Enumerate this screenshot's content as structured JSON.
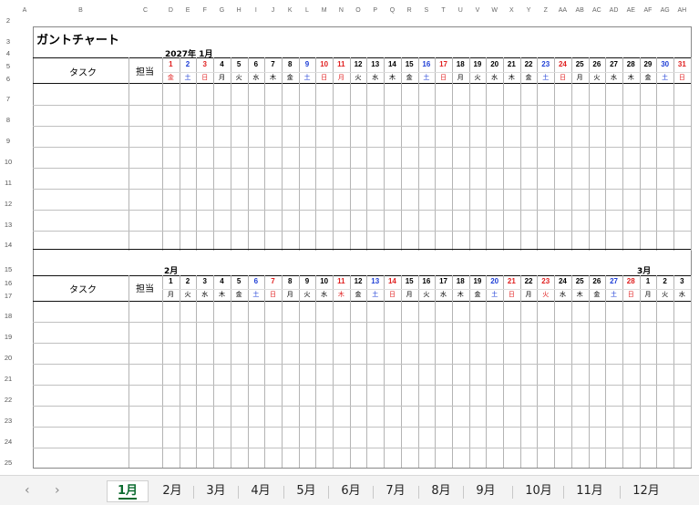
{
  "sheet": {
    "title": "ガントチャート",
    "column_letters": [
      "A",
      "B",
      "C",
      "D",
      "E",
      "F",
      "G",
      "H",
      "I",
      "J",
      "K",
      "L",
      "M",
      "N",
      "O",
      "P",
      "Q",
      "R",
      "S",
      "T",
      "U",
      "V",
      "W",
      "X",
      "Y",
      "Z",
      "AA",
      "AB",
      "AC",
      "AD",
      "AE",
      "AF",
      "AG",
      "AH"
    ],
    "row_numbers": [
      "2",
      "3",
      "4",
      "5",
      "6",
      "7",
      "8",
      "9",
      "10",
      "11",
      "12",
      "13",
      "14",
      "15",
      "16",
      "17",
      "18",
      "19",
      "20",
      "21",
      "22",
      "23",
      "24",
      "25"
    ],
    "colors": {
      "weekday": "#000000",
      "saturday": "#1f3fd6",
      "sunday_holiday": "#e02020",
      "grid": "#b4b4b4",
      "tab_active": "#0b6b2f"
    }
  },
  "block1": {
    "month_label": "2027年 1月",
    "task_header": "タスク",
    "owner_header": "担当",
    "days": [
      {
        "d": "1",
        "w": "金",
        "c": "h"
      },
      {
        "d": "2",
        "w": "土",
        "c": "s"
      },
      {
        "d": "3",
        "w": "日",
        "c": "h"
      },
      {
        "d": "4",
        "w": "月",
        "c": "n"
      },
      {
        "d": "5",
        "w": "火",
        "c": "n"
      },
      {
        "d": "6",
        "w": "水",
        "c": "n"
      },
      {
        "d": "7",
        "w": "木",
        "c": "n"
      },
      {
        "d": "8",
        "w": "金",
        "c": "n"
      },
      {
        "d": "9",
        "w": "土",
        "c": "s"
      },
      {
        "d": "10",
        "w": "日",
        "c": "h"
      },
      {
        "d": "11",
        "w": "月",
        "c": "h"
      },
      {
        "d": "12",
        "w": "火",
        "c": "n"
      },
      {
        "d": "13",
        "w": "水",
        "c": "n"
      },
      {
        "d": "14",
        "w": "木",
        "c": "n"
      },
      {
        "d": "15",
        "w": "金",
        "c": "n"
      },
      {
        "d": "16",
        "w": "土",
        "c": "s"
      },
      {
        "d": "17",
        "w": "日",
        "c": "h"
      },
      {
        "d": "18",
        "w": "月",
        "c": "n"
      },
      {
        "d": "19",
        "w": "火",
        "c": "n"
      },
      {
        "d": "20",
        "w": "水",
        "c": "n"
      },
      {
        "d": "21",
        "w": "木",
        "c": "n"
      },
      {
        "d": "22",
        "w": "金",
        "c": "n"
      },
      {
        "d": "23",
        "w": "土",
        "c": "s"
      },
      {
        "d": "24",
        "w": "日",
        "c": "h"
      },
      {
        "d": "25",
        "w": "月",
        "c": "n"
      },
      {
        "d": "26",
        "w": "火",
        "c": "n"
      },
      {
        "d": "27",
        "w": "水",
        "c": "n"
      },
      {
        "d": "28",
        "w": "木",
        "c": "n"
      },
      {
        "d": "29",
        "w": "金",
        "c": "n"
      },
      {
        "d": "30",
        "w": "土",
        "c": "s"
      },
      {
        "d": "31",
        "w": "日",
        "c": "h"
      }
    ]
  },
  "block2": {
    "month_label": "2月",
    "month_label_2": "3月",
    "task_header": "タスク",
    "owner_header": "担当",
    "days": [
      {
        "d": "1",
        "w": "月",
        "c": "n"
      },
      {
        "d": "2",
        "w": "火",
        "c": "n"
      },
      {
        "d": "3",
        "w": "水",
        "c": "n"
      },
      {
        "d": "4",
        "w": "木",
        "c": "n"
      },
      {
        "d": "5",
        "w": "金",
        "c": "n"
      },
      {
        "d": "6",
        "w": "土",
        "c": "s"
      },
      {
        "d": "7",
        "w": "日",
        "c": "h"
      },
      {
        "d": "8",
        "w": "月",
        "c": "n"
      },
      {
        "d": "9",
        "w": "火",
        "c": "n"
      },
      {
        "d": "10",
        "w": "水",
        "c": "n"
      },
      {
        "d": "11",
        "w": "木",
        "c": "h"
      },
      {
        "d": "12",
        "w": "金",
        "c": "n"
      },
      {
        "d": "13",
        "w": "土",
        "c": "s"
      },
      {
        "d": "14",
        "w": "日",
        "c": "h"
      },
      {
        "d": "15",
        "w": "月",
        "c": "n"
      },
      {
        "d": "16",
        "w": "火",
        "c": "n"
      },
      {
        "d": "17",
        "w": "水",
        "c": "n"
      },
      {
        "d": "18",
        "w": "木",
        "c": "n"
      },
      {
        "d": "19",
        "w": "金",
        "c": "n"
      },
      {
        "d": "20",
        "w": "土",
        "c": "s"
      },
      {
        "d": "21",
        "w": "日",
        "c": "h"
      },
      {
        "d": "22",
        "w": "月",
        "c": "n"
      },
      {
        "d": "23",
        "w": "火",
        "c": "h"
      },
      {
        "d": "24",
        "w": "水",
        "c": "n"
      },
      {
        "d": "25",
        "w": "木",
        "c": "n"
      },
      {
        "d": "26",
        "w": "金",
        "c": "n"
      },
      {
        "d": "27",
        "w": "土",
        "c": "s"
      },
      {
        "d": "28",
        "w": "日",
        "c": "h"
      },
      {
        "d": "1",
        "w": "月",
        "c": "n"
      },
      {
        "d": "2",
        "w": "火",
        "c": "n"
      },
      {
        "d": "3",
        "w": "水",
        "c": "n"
      }
    ]
  },
  "tabs": {
    "prev_icon": "chevron-left-icon",
    "next_icon": "chevron-right-icon",
    "prev_glyph": "‹",
    "next_glyph": "›",
    "active_index": 0,
    "items": [
      "1月",
      "2月",
      "3月",
      "4月",
      "5月",
      "6月",
      "7月",
      "8月",
      "9月",
      "10月",
      "11月",
      "12月"
    ]
  }
}
